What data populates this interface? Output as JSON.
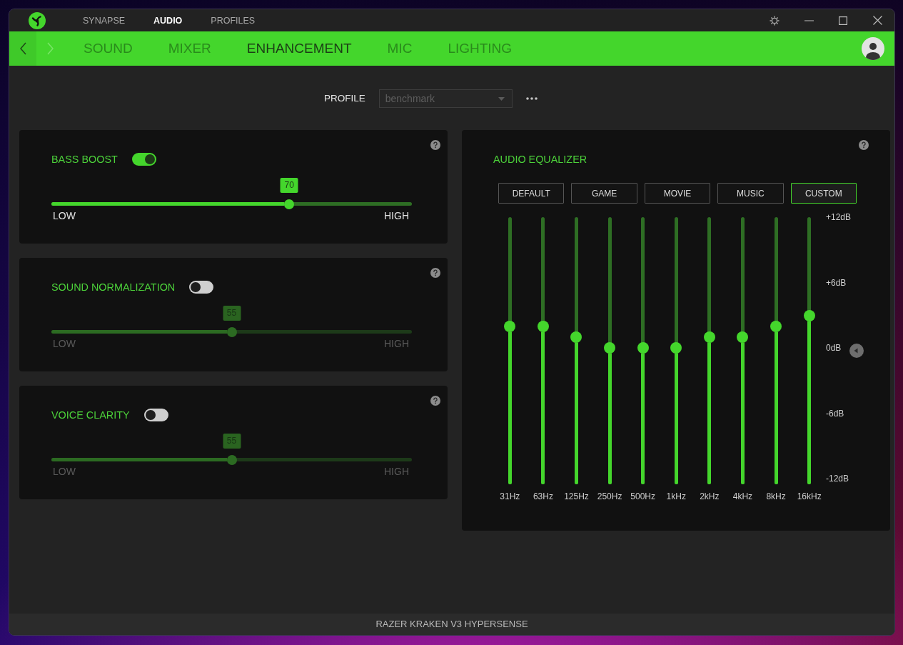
{
  "title_bar": {
    "tabs": [
      {
        "label": "SYNAPSE",
        "selected": false
      },
      {
        "label": "AUDIO",
        "selected": true
      },
      {
        "label": "PROFILES",
        "selected": false
      }
    ]
  },
  "nav_bar": {
    "buttons": [
      {
        "kind": "back",
        "disabled": false
      },
      {
        "kind": "forward",
        "disabled": true
      }
    ],
    "tabs": [
      {
        "label": "SOUND",
        "selected": false
      },
      {
        "label": "MIXER",
        "selected": false
      },
      {
        "label": "ENHANCEMENT",
        "selected": true
      },
      {
        "label": "MIC",
        "selected": false
      },
      {
        "label": "LIGHTING",
        "selected": false
      }
    ]
  },
  "profile": {
    "label": "PROFILE",
    "value": "benchmark",
    "disabled": true
  },
  "features": [
    {
      "title": "BASS BOOST",
      "on": true,
      "value": "70",
      "level": 0.66,
      "low_label": "LOW",
      "high_label": "HIGH"
    },
    {
      "title": "SOUND NORMALIZATION",
      "on": false,
      "value": "55",
      "level": 0.5,
      "low_label": "LOW",
      "high_label": "HIGH"
    },
    {
      "title": "VOICE CLARITY",
      "on": false,
      "value": "55",
      "level": 0.5,
      "low_label": "LOW",
      "high_label": "HIGH"
    }
  ],
  "equalizer": {
    "title": "AUDIO EQUALIZER",
    "presets": [
      {
        "label": "DEFAULT",
        "selected": false
      },
      {
        "label": "GAME",
        "selected": false
      },
      {
        "label": "MOVIE",
        "selected": false
      },
      {
        "label": "MUSIC",
        "selected": false
      },
      {
        "label": "CUSTOM",
        "selected": true
      }
    ],
    "bands": [
      {
        "label": "31Hz",
        "level": 0.59
      },
      {
        "label": "63Hz",
        "level": 0.59
      },
      {
        "label": "125Hz",
        "level": 0.55
      },
      {
        "label": "250Hz",
        "level": 0.51
      },
      {
        "label": "500Hz",
        "level": 0.51
      },
      {
        "label": "1kHz",
        "level": 0.51
      },
      {
        "label": "2kHz",
        "level": 0.55
      },
      {
        "label": "4kHz",
        "level": 0.55
      },
      {
        "label": "8kHz",
        "level": 0.59
      },
      {
        "label": "16kHz",
        "level": 0.63
      }
    ],
    "scale": [
      "+12dB",
      "+6dB",
      "0dB",
      "-6dB",
      "-12dB"
    ]
  },
  "status_bar": {
    "device": "RAZER KRAKEN V3 HYPERSENSE"
  }
}
